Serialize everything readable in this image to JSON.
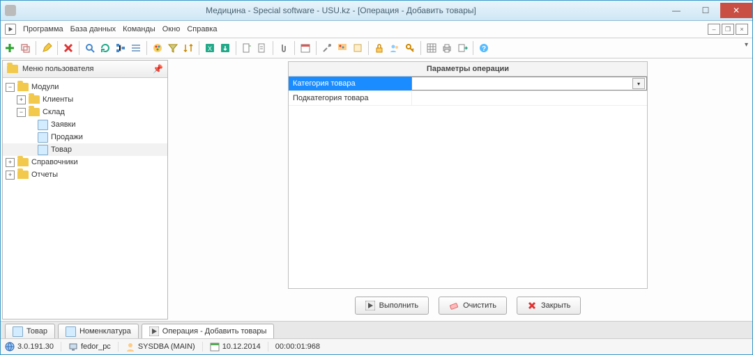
{
  "title": "Медицина - Special software - USU.kz - [Операция - Добавить товары]",
  "menu": {
    "items": [
      "Программа",
      "База данных",
      "Команды",
      "Окно",
      "Справка"
    ]
  },
  "sidebar": {
    "title": "Меню пользователя",
    "nodes": {
      "root": "Модули",
      "clients": "Клиенты",
      "sklad": "Склад",
      "zayavki": "Заявки",
      "prodazhi": "Продажи",
      "tovar": "Товар",
      "sprav": "Справочники",
      "otchety": "Отчеты"
    }
  },
  "params": {
    "title": "Параметры операции",
    "rows": [
      {
        "label": "Категория товара",
        "value": ""
      },
      {
        "label": "Подкатегория товара",
        "value": ""
      }
    ]
  },
  "buttons": {
    "run": "Выполнить",
    "clear": "Очистить",
    "close": "Закрыть"
  },
  "tabs": {
    "t1": "Товар",
    "t2": "Номенклатура",
    "t3": "Операция - Добавить товары"
  },
  "status": {
    "ip": "3.0.191.30",
    "host": "fedor_pc",
    "user": "SYSDBA (MAIN)",
    "date": "10.12.2014",
    "time": "00:00:01:968"
  }
}
